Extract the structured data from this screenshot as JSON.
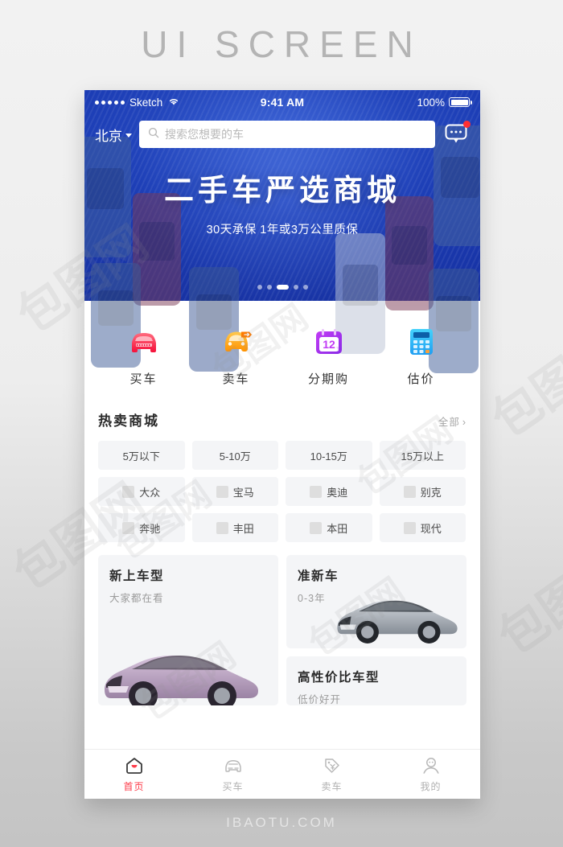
{
  "page": {
    "heading": "UI SCREEN",
    "footer": "IBAOTU.COM",
    "watermark": "包图网"
  },
  "statusbar": {
    "carrier": "Sketch",
    "wifi_icon": "wifi-icon",
    "time": "9:41 AM",
    "battery_percent": "100%",
    "battery_icon": "battery-full-icon"
  },
  "searchbar": {
    "city": "北京",
    "city_caret_icon": "chevron-down-icon",
    "search_icon": "search-icon",
    "placeholder": "搜索您想要的车",
    "message_icon": "chat-bubble-icon",
    "has_unread_badge": true
  },
  "hero": {
    "title": "二手车严选商城",
    "subtitle": "30天承保 1年或3万公里质保",
    "dots_total": 5,
    "dots_active_index": 2,
    "bg_color": "#1c3db5"
  },
  "quick_actions": [
    {
      "label": "买车",
      "icon": "car-front-red-icon",
      "color": "#f5334a"
    },
    {
      "label": "卖车",
      "icon": "car-tag-orange-icon",
      "color": "#ffa413"
    },
    {
      "label": "分期购",
      "icon": "calendar-12-icon",
      "color": "#b93df0",
      "badge_number": "12"
    },
    {
      "label": "估价",
      "icon": "calculator-icon",
      "color": "#25b7f5"
    }
  ],
  "section": {
    "title": "热卖商城",
    "more_label": "全部",
    "more_icon": "chevron-right-icon"
  },
  "price_chips": [
    {
      "label": "5万以下"
    },
    {
      "label": "5-10万"
    },
    {
      "label": "10-15万"
    },
    {
      "label": "15万以上"
    }
  ],
  "brand_chips": [
    {
      "label": "大众",
      "logo": "brand-logo-placeholder"
    },
    {
      "label": "宝马",
      "logo": "brand-logo-placeholder"
    },
    {
      "label": "奥迪",
      "logo": "brand-logo-placeholder"
    },
    {
      "label": "别克",
      "logo": "brand-logo-placeholder"
    },
    {
      "label": "奔驰",
      "logo": "brand-logo-placeholder"
    },
    {
      "label": "丰田",
      "logo": "brand-logo-placeholder"
    },
    {
      "label": "本田",
      "logo": "brand-logo-placeholder"
    },
    {
      "label": "现代",
      "logo": "brand-logo-placeholder"
    }
  ],
  "car_cards": {
    "new_arrival": {
      "title": "新上车型",
      "subtitle": "大家都在看",
      "car_color": "#b9a2bd"
    },
    "nearly_new": {
      "title": "准新车",
      "subtitle": "0-3年",
      "car_color": "#9aa3ad"
    },
    "value": {
      "title": "高性价比车型",
      "subtitle": "低价好开"
    }
  },
  "tabbar": {
    "active_color": "#fd3c4a",
    "items": [
      {
        "label": "首页",
        "icon": "home-icon",
        "active": true
      },
      {
        "label": "买车",
        "icon": "car-icon",
        "active": false
      },
      {
        "label": "卖车",
        "icon": "price-tag-icon",
        "active": false
      },
      {
        "label": "我的",
        "icon": "user-icon",
        "active": false
      }
    ]
  }
}
